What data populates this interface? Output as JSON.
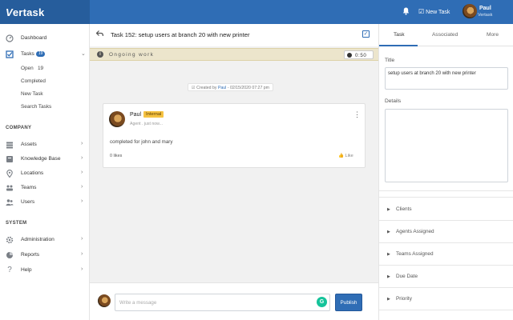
{
  "app": {
    "brand_v": "V",
    "brand_rest": "ertask"
  },
  "topbar": {
    "bell_icon": "bell-icon",
    "new_task_label": "New Task",
    "user_name": "Paul",
    "user_org": "Vertask"
  },
  "sidebar": {
    "dashboard": "Dashboard",
    "tasks": "Tasks",
    "tasks_count": "19",
    "tasks_sub": {
      "open": "Open",
      "open_count": "19",
      "completed": "Completed",
      "new_task": "New Task",
      "search_tasks": "Search Tasks"
    },
    "company_header": "COMPANY",
    "company_items": [
      "Assets",
      "Knowledge Base",
      "Locations",
      "Teams",
      "Users"
    ],
    "system_header": "SYSTEM",
    "system_items": [
      "Administration",
      "Reports",
      "Help"
    ]
  },
  "task": {
    "title": "Task 152: setup users at branch 20 with new printer",
    "status": "Ongoing work",
    "timer": "0:50",
    "created_prefix": "Created by ",
    "created_by": "Paul",
    "created_suffix": " - 02/15/2020 07:27 pm"
  },
  "comment": {
    "author": "Paul",
    "tag": "Internal",
    "role": "Agent . just now...",
    "body": "completed for john and mary",
    "likes": "0 likes",
    "like_label": "Like"
  },
  "composer": {
    "placeholder": "Write a message",
    "grammarly": "G",
    "publish_label": "Publish"
  },
  "panel": {
    "tabs": [
      "Task",
      "Associated",
      "More"
    ],
    "title_label": "Title",
    "title_value": "setup users at branch 20 with new printer",
    "details_label": "Details",
    "details_value": "",
    "accordions": [
      "Clients",
      "Agents Assigned",
      "Teams Assigned",
      "Due Date",
      "Priority"
    ]
  },
  "colors": {
    "primary": "#2f6db5",
    "status_bg": "#ece5cc",
    "tag": "#f5c242"
  }
}
